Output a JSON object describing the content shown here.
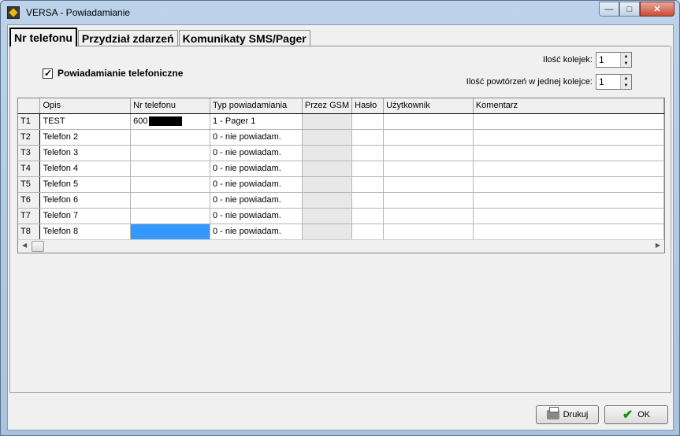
{
  "window": {
    "title": "VERSA - Powiadamianie"
  },
  "tabs": [
    {
      "label": "Nr telefonu"
    },
    {
      "label": "Przydział zdarzeń"
    },
    {
      "label": "Komunikaty SMS/Pager"
    }
  ],
  "notification": {
    "checkbox_label": "Powiadamianie telefoniczne",
    "checked": true
  },
  "queues": {
    "count_label": "Ilość kolejek:",
    "count_value": "1",
    "repeats_label": "Ilość powtórzeń w jednej kolejce:",
    "repeats_value": "1"
  },
  "grid": {
    "columns": [
      "",
      "Opis",
      "Nr telefonu",
      "Typ powiadamiania",
      "Przez GSM",
      "Hasło",
      "Użytkownik",
      "Komentarz"
    ],
    "rows": [
      {
        "id": "T1",
        "opis": "TEST",
        "nr": "600",
        "typ": "1 - Pager 1"
      },
      {
        "id": "T2",
        "opis": "Telefon 2",
        "nr": "",
        "typ": "0 - nie powiadam."
      },
      {
        "id": "T3",
        "opis": "Telefon 3",
        "nr": "",
        "typ": "0 - nie powiadam."
      },
      {
        "id": "T4",
        "opis": "Telefon 4",
        "nr": "",
        "typ": "0 - nie powiadam."
      },
      {
        "id": "T5",
        "opis": "Telefon 5",
        "nr": "",
        "typ": "0 - nie powiadam."
      },
      {
        "id": "T6",
        "opis": "Telefon 6",
        "nr": "",
        "typ": "0 - nie powiadam."
      },
      {
        "id": "T7",
        "opis": "Telefon 7",
        "nr": "",
        "typ": "0 - nie powiadam."
      },
      {
        "id": "T8",
        "opis": "Telefon 8",
        "nr": "",
        "typ": "0 - nie powiadam."
      }
    ]
  },
  "buttons": {
    "print": "Drukuj",
    "ok": "OK"
  },
  "icons": {
    "app": "versa-app-icon",
    "print": "printer-icon",
    "ok": "checkmark-icon"
  },
  "colors": {
    "selection": "#3399ff",
    "ok_check": "#1a8f1a"
  }
}
